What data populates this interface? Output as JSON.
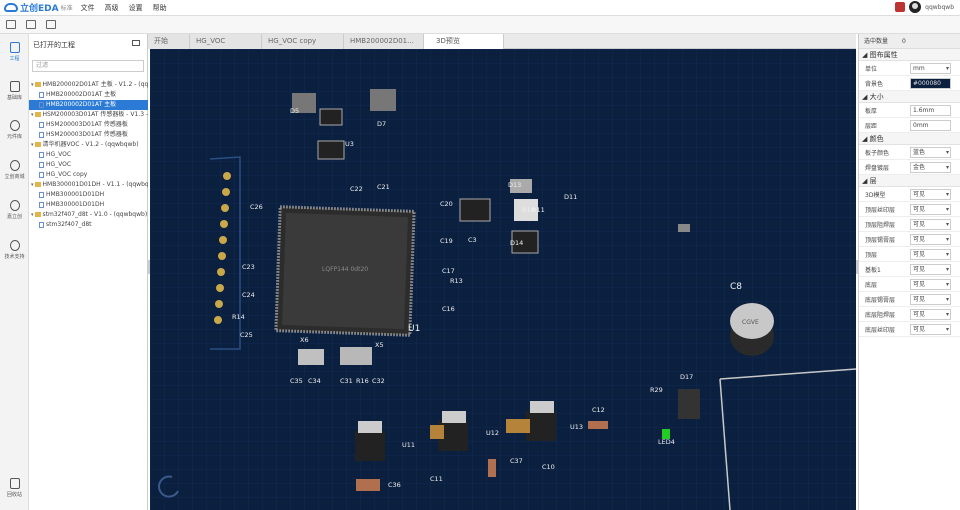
{
  "app": {
    "logo": "立创EDA",
    "edition": "标准",
    "menus": [
      "文件",
      "高级",
      "设置",
      "帮助"
    ],
    "user": "qqwbqwb"
  },
  "sidebar": {
    "items": [
      "工程",
      "基础库",
      "元件库",
      "立创商城",
      "嘉立创",
      "技术支持"
    ],
    "trash": "回收站"
  },
  "panel": {
    "title": "已打开的工程",
    "filter_placeholder": "过滤",
    "tree": [
      {
        "type": "project",
        "label": "HMB200002D01AT 主板 - V1.2 - (qqwbqwb)"
      },
      {
        "type": "doc",
        "label": "HMB200002D01AT 主板"
      },
      {
        "type": "doc",
        "label": "HMB200002D01AT 主板",
        "selected": true
      },
      {
        "type": "project",
        "label": "HSM200003D01AT 传感器板 - V1.3 - (qqwbqwb)"
      },
      {
        "type": "doc",
        "label": "HSM200003D01AT 传感器板"
      },
      {
        "type": "doc",
        "label": "HSM200003D01AT 传感器板"
      },
      {
        "type": "project",
        "label": "清华机器VOC - V1.2 - (qqwbqwb)"
      },
      {
        "type": "doc",
        "label": "HG_VOC"
      },
      {
        "type": "doc",
        "label": "HG_VOC"
      },
      {
        "type": "doc",
        "label": "HG_VOC copy"
      },
      {
        "type": "project",
        "label": "HMB300001D01DH - V1.1 - (qqwbqwb)"
      },
      {
        "type": "doc",
        "label": "HMB300001D01DH"
      },
      {
        "type": "doc",
        "label": "HMB300001D01DH"
      },
      {
        "type": "project",
        "label": "stm32f407_d8t - V1.0 - (qqwbqwb)"
      },
      {
        "type": "doc",
        "label": "stm32f407_d8t"
      }
    ]
  },
  "tabs": [
    "开始",
    "HG_VOC",
    "HG_VOC copy",
    "HMB200002D01...",
    "3D预览"
  ],
  "right": {
    "header": "选中数量",
    "count": "0",
    "sections": [
      {
        "title": "图布属性",
        "rows": [
          {
            "label": "单位",
            "value": "mm",
            "select": true
          },
          {
            "label": "背景色",
            "value": "#000080",
            "dark": true
          }
        ]
      },
      {
        "title": "大小",
        "rows": [
          {
            "label": "板厚",
            "value": "1.6mm"
          },
          {
            "label": "层距",
            "value": "0mm"
          }
        ]
      },
      {
        "title": "颜色",
        "rows": [
          {
            "label": "板子颜色",
            "value": "蓝色",
            "select": true
          },
          {
            "label": "焊盘镀层",
            "value": "金色",
            "select": true
          }
        ]
      },
      {
        "title": "层",
        "rows": [
          {
            "label": "3D模型",
            "value": "可见",
            "select": true
          },
          {
            "label": "顶层丝印层",
            "value": "可见",
            "select": true
          },
          {
            "label": "顶层阻焊层",
            "value": "可见",
            "select": true
          },
          {
            "label": "顶层锡膏层",
            "value": "可见",
            "select": true
          },
          {
            "label": "顶层",
            "value": "可见",
            "select": true
          },
          {
            "label": "基板1",
            "value": "可见",
            "select": true
          },
          {
            "label": "底层",
            "value": "可见",
            "select": true
          },
          {
            "label": "底层锡膏层",
            "value": "可见",
            "select": true
          },
          {
            "label": "底层阻焊层",
            "value": "可见",
            "select": true
          },
          {
            "label": "底层丝印层",
            "value": "可见",
            "select": true
          }
        ]
      }
    ]
  },
  "pcb": {
    "labels": [
      "U3",
      "D7",
      "D5",
      "C22",
      "C21",
      "C26",
      "C20",
      "U1",
      "D13",
      "D11",
      "R10",
      "R11",
      "D14",
      "C19",
      "C3",
      "C23",
      "C24",
      "R14",
      "C25",
      "C17",
      "R13",
      "C16",
      "C8",
      "X6",
      "X5",
      "C35",
      "C34",
      "C31",
      "R16",
      "C32",
      "R29",
      "D17",
      "LED4",
      "C12",
      "U11",
      "U12",
      "U13",
      "C37",
      "C10",
      "C11",
      "C36"
    ],
    "u1_silk": "LQFP144 0dt20",
    "cap_silk": "CGVE"
  }
}
